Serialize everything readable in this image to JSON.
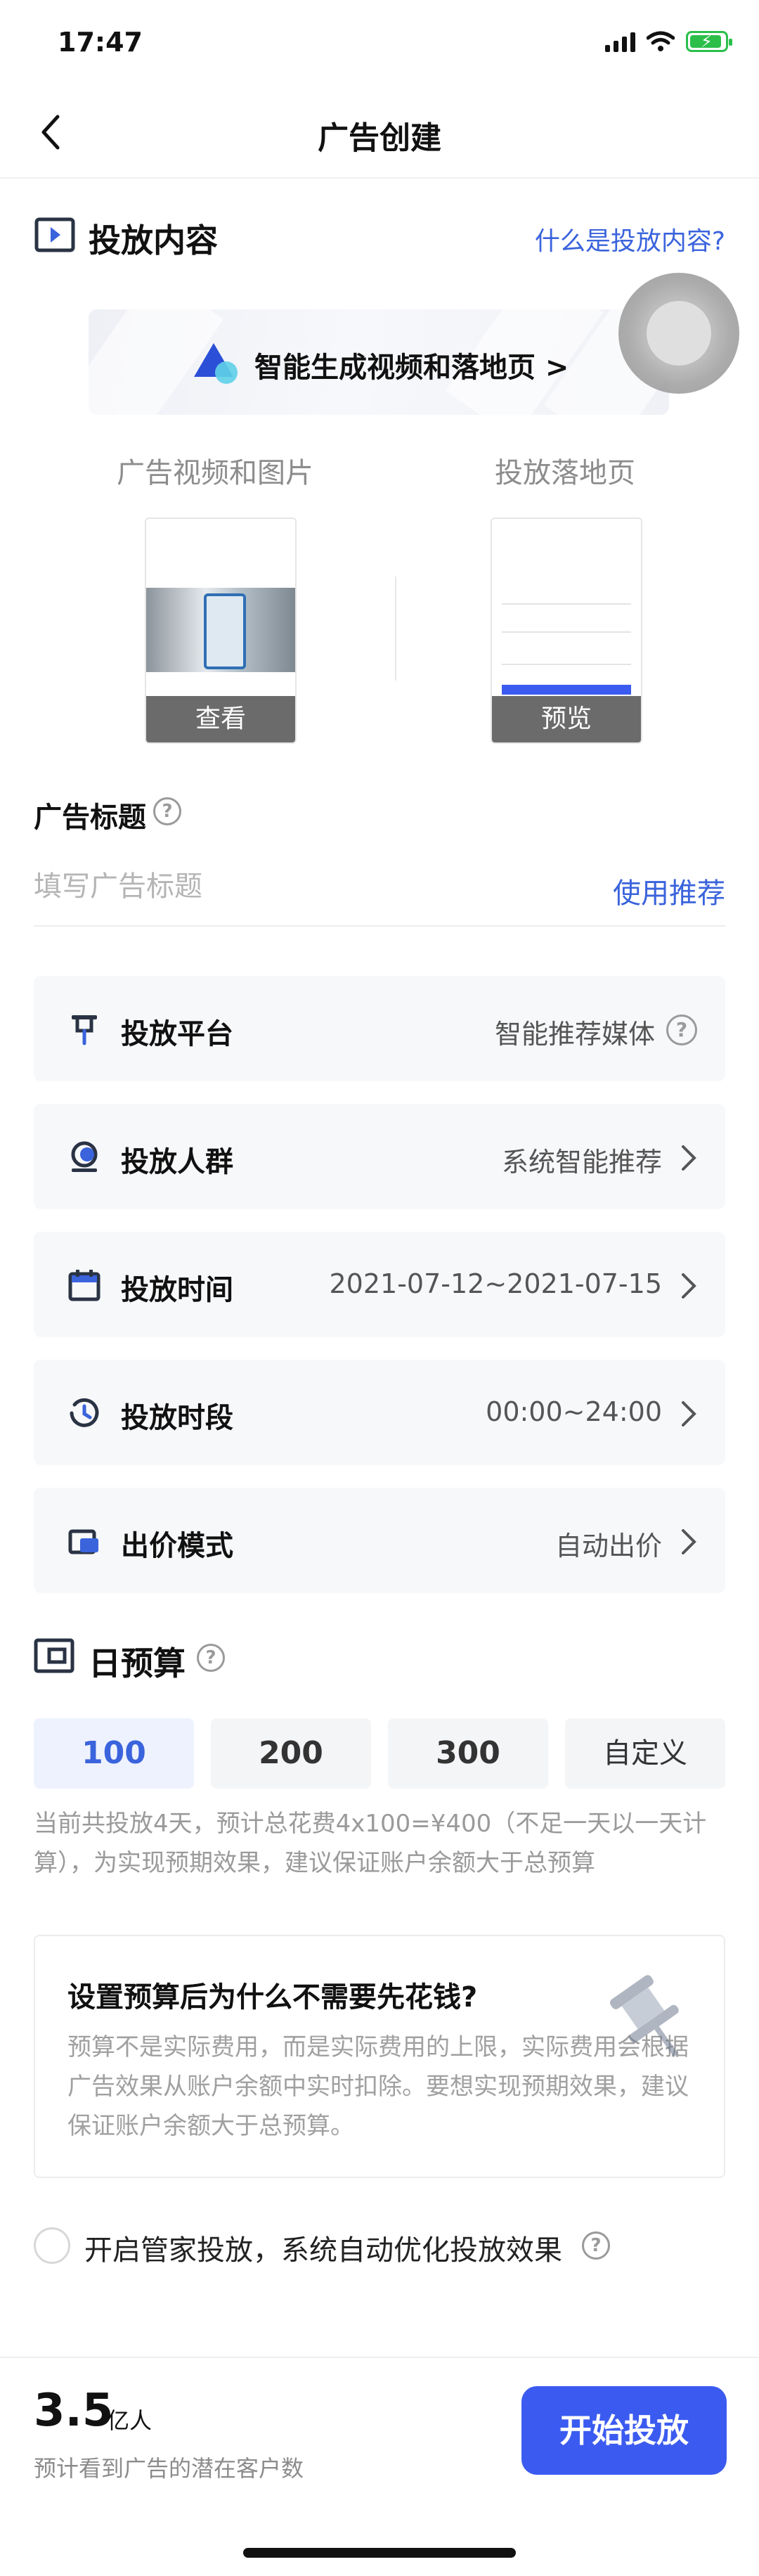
{
  "status_bar": {
    "time": "17:47"
  },
  "nav": {
    "title": "广告创建"
  },
  "content_section": {
    "title": "投放内容",
    "help_link": "什么是投放内容?",
    "banner_text": "智能生成视频和落地页 >",
    "media_column": {
      "label": "广告视频和图片",
      "action": "查看"
    },
    "landing_column": {
      "label": "投放落地页",
      "action": "预览"
    }
  },
  "ad_title": {
    "label": "广告标题",
    "placeholder": "填写广告标题",
    "recommend": "使用推荐"
  },
  "settings": [
    {
      "label": "投放平台",
      "value": "智能推荐媒体",
      "icon": "pin-icon"
    },
    {
      "label": "投放人群",
      "value": "系统智能推荐",
      "icon": "audience-icon"
    },
    {
      "label": "投放时间",
      "value": "2021-07-12~2021-07-15",
      "icon": "calendar-icon"
    },
    {
      "label": "投放时段",
      "value": "00:00~24:00",
      "icon": "clock-icon"
    },
    {
      "label": "出价模式",
      "value": "自动出价",
      "icon": "bid-icon"
    }
  ],
  "budget": {
    "title": "日预算",
    "options": [
      "100",
      "200",
      "300",
      "自定义"
    ],
    "selected": "100",
    "note": "当前共投放4天，预计总花费4x100=¥400（不足一天以一天计算），为实现预期效果，建议保证账户余额大于总预算"
  },
  "info_card": {
    "title": "设置预算后为什么不需要先花钱?",
    "body": "预算不是实际费用，而是实际费用的上限，实际费用会根据广告效果从账户余额中实时扣除。要想实现预期效果，建议保证账户余额大于总预算。"
  },
  "manager_option": {
    "label": "开启管家投放，系统自动优化投放效果",
    "checked": false
  },
  "footer": {
    "reach_value": "3.5",
    "reach_unit": "亿人",
    "reach_desc": "预计看到广告的潜在客户数",
    "start_button": "开始投放"
  },
  "colors": {
    "accent": "#3a63dc",
    "button": "#3b5bf0",
    "row_bg": "#f7f8fa"
  }
}
